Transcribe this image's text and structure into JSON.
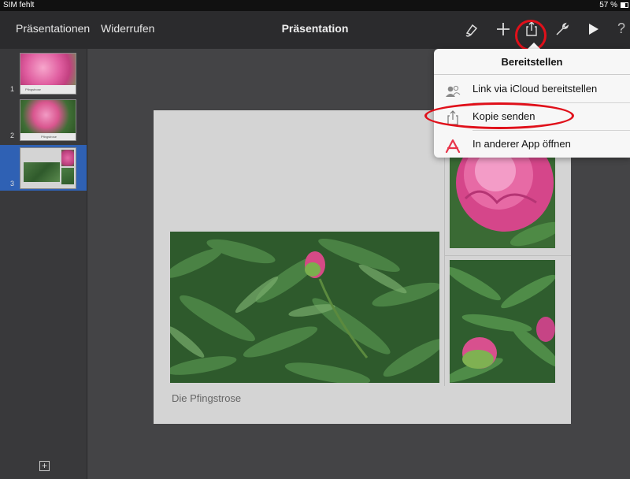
{
  "statusbar": {
    "carrier": "SIM fehlt",
    "battery": "57 %"
  },
  "toolbar": {
    "presentations_label": "Präsentationen",
    "undo_label": "Widerrufen",
    "title": "Präsentation",
    "help_label": "?"
  },
  "sidebar": {
    "slides": [
      {
        "number": "1",
        "caption": "Pfingstrose"
      },
      {
        "number": "2",
        "caption": "Pfingstrose"
      },
      {
        "number": "3",
        "caption": ""
      }
    ],
    "selected_index": 3
  },
  "slide": {
    "caption": "Die Pfingstrose"
  },
  "share_popover": {
    "title": "Bereitstellen",
    "items": [
      {
        "label": "Link via iCloud bereitstellen",
        "icon": "people-icon"
      },
      {
        "label": "Kopie senden",
        "icon": "share-icon"
      },
      {
        "label": "In anderer App öffnen",
        "icon": "app-store-icon"
      }
    ]
  },
  "colors": {
    "highlight": "#e0101a",
    "selection": "#2f61b4",
    "accent_red": "#e8344a"
  }
}
